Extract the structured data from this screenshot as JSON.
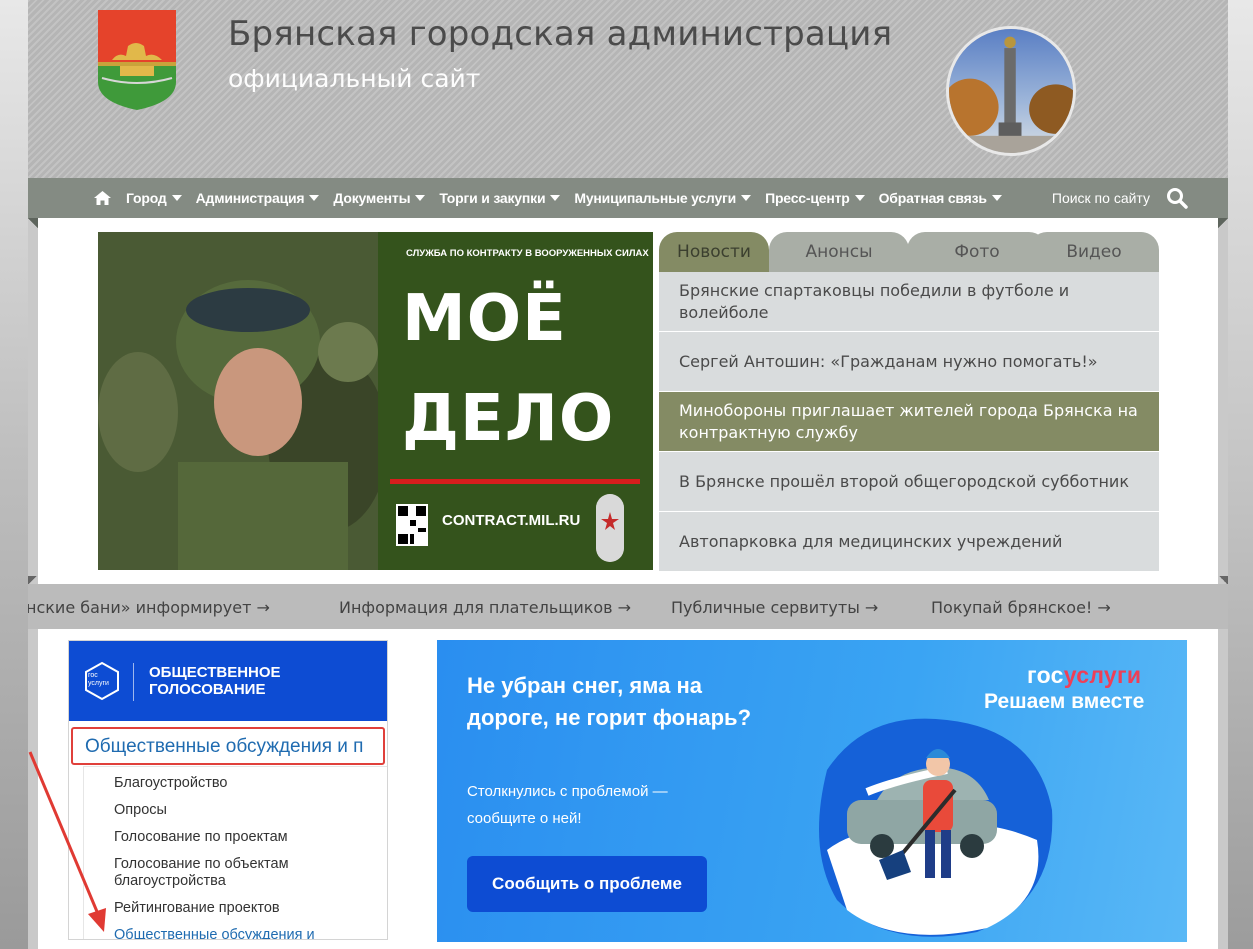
{
  "header": {
    "title": "Брянская городская администрация",
    "subtitle": "официальный сайт"
  },
  "nav": {
    "items": [
      {
        "label": "Город"
      },
      {
        "label": "Администрация"
      },
      {
        "label": "Документы"
      },
      {
        "label": "Торги и закупки"
      },
      {
        "label": "Муниципальные услуги"
      },
      {
        "label": "Пресс-центр"
      },
      {
        "label": "Обратная связь"
      }
    ],
    "search_label": "Поиск по сайту",
    "home_icon": "home-icon",
    "search_icon": "search-icon"
  },
  "promo_banner": {
    "caption": "СЛУЖБА ПО КОНТРАКТУ В ВООРУЖЕННЫХ СИЛАХ",
    "line1": "МОЁ",
    "line2": "ДЕЛО",
    "url": "CONTRACT.MIL.RU"
  },
  "news": {
    "tabs": [
      {
        "label": "Новости",
        "active": true
      },
      {
        "label": "Анонсы",
        "active": false
      },
      {
        "label": "Фото",
        "active": false
      },
      {
        "label": "Видео",
        "active": false
      }
    ],
    "items": [
      {
        "text": "Брянские спартаковцы победили в футболе и волейболе",
        "highlighted": false
      },
      {
        "text": "Сергей Антошин: «Гражданам нужно помогать!»",
        "highlighted": false
      },
      {
        "text": "Минобороны приглашает жителей города Брянска на контрактную службу",
        "highlighted": true
      },
      {
        "text": "В Брянске прошёл второй общегородской субботник",
        "highlighted": false
      },
      {
        "text": "Автопарковка для медицинских учреждений",
        "highlighted": false
      }
    ]
  },
  "ticker": {
    "items": [
      "нские бани» информирует →",
      "Информация для плательщиков →",
      "Публичные сервитуты →",
      "Покупай брянское! →"
    ]
  },
  "vote_widget": {
    "logo_text_1": "гос",
    "logo_text_2": "услуги",
    "title_line1": "ОБЩЕСТВЕННОЕ",
    "title_line2": "ГОЛОСОВАНИЕ",
    "selected_value": "Общественные обсуждения и п",
    "options": [
      "Благоустройство",
      "Опросы",
      "Голосование по проектам",
      "Голосование по объектам благоустройства",
      "Рейтингование проектов",
      "Общественные обсуждения и"
    ]
  },
  "gos_banner": {
    "headline": "Не убран снег, яма на дороге, не горит фонарь?",
    "subtext": "Столкнулись с проблемой — сообщите о ней!",
    "button_label": "Сообщить о проблеме",
    "brand_part1": "гос",
    "brand_part2": "услуги",
    "slogan": "Решаем вместе"
  },
  "colors": {
    "nav_bg": "#848b83",
    "tab_active": "#848b64",
    "gos_blue": "#0d4cd3",
    "highlight_red": "#e0403b"
  }
}
